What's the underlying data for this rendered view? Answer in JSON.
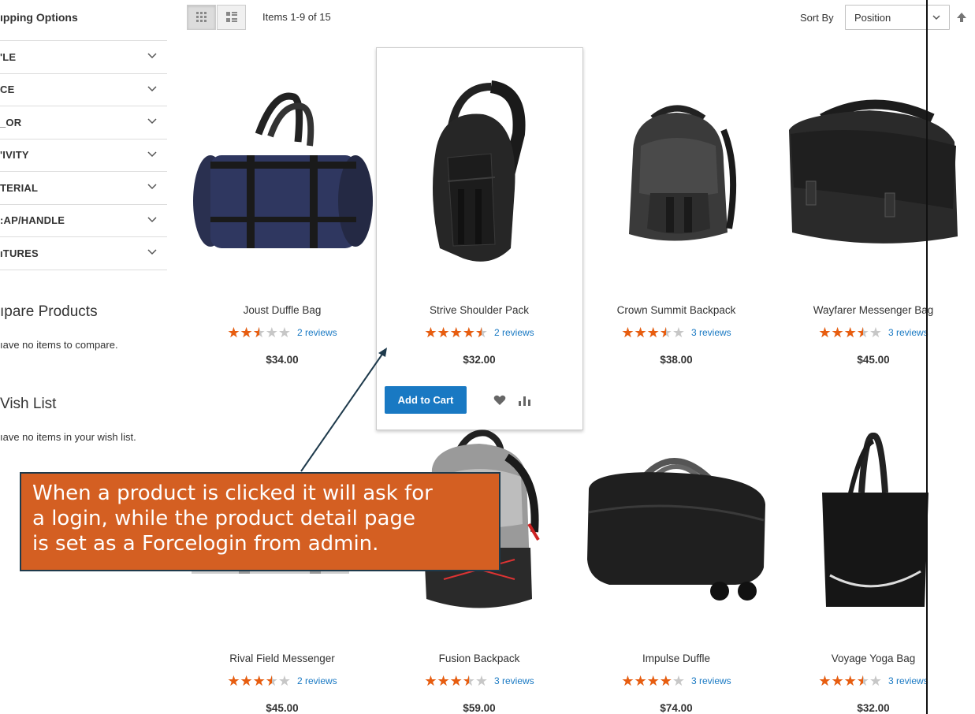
{
  "sidebar": {
    "title": "ıpping Options",
    "filters": [
      {
        "label": "'LE"
      },
      {
        "label": "CE"
      },
      {
        "label": "_OR"
      },
      {
        "label": "'IVITY"
      },
      {
        "label": "TERIAL"
      },
      {
        "label": ":AP/HANDLE"
      },
      {
        "label": "ıTURES"
      }
    ],
    "compare_title": "ıpare Products",
    "compare_text": "ıave no items to compare.",
    "wishlist_title": "Vish List",
    "wishlist_text": "ıave no items in your wish list."
  },
  "toolbar": {
    "amount": "Items 1-9 of 15",
    "sort_label": "Sort By",
    "sort_value": "Position",
    "view_modes": [
      "grid-icon",
      "list-icon"
    ]
  },
  "products": [
    {
      "name": "Joust Duffle Bag",
      "rating": 2.5,
      "reviews": "2 reviews",
      "price": "$34.00"
    },
    {
      "name": "Strive Shoulder Pack",
      "rating": 4.5,
      "reviews": "2 reviews",
      "price": "$32.00"
    },
    {
      "name": "Crown Summit Backpack",
      "rating": 3.5,
      "reviews": "3 reviews",
      "price": "$38.00"
    },
    {
      "name": "Wayfarer Messenger Bag",
      "rating": 3.5,
      "reviews": "3 reviews",
      "price": "$45.00"
    },
    {
      "name": "Rival Field Messenger",
      "rating": 3.5,
      "reviews": "2 reviews",
      "price": "$45.00"
    },
    {
      "name": "Fusion Backpack",
      "rating": 3.5,
      "reviews": "3 reviews",
      "price": "$59.00"
    },
    {
      "name": "Impulse Duffle",
      "rating": 4.0,
      "reviews": "3 reviews",
      "price": "$74.00"
    },
    {
      "name": "Voyage Yoga Bag",
      "rating": 3.5,
      "reviews": "3 reviews",
      "price": "$32.00"
    }
  ],
  "card_actions": {
    "add_to_cart": "Add to Cart",
    "wishlist_icon": "heart-icon",
    "compare_icon": "bar-chart-icon"
  },
  "annotation": {
    "text": "When a product is clicked it will ask for a login, while the product detail page is set as a Forcelogin from admin.",
    "line1": "When a product is clicked it will ask for",
    "line2": "a login, while the product detail page",
    "line3": "is set as a Forcelogin from admin."
  },
  "colors": {
    "star": "#e85d0f",
    "link": "#1979c3",
    "button": "#1979c3",
    "callout_bg": "#d45f22",
    "callout_border": "#1e3a4c"
  }
}
